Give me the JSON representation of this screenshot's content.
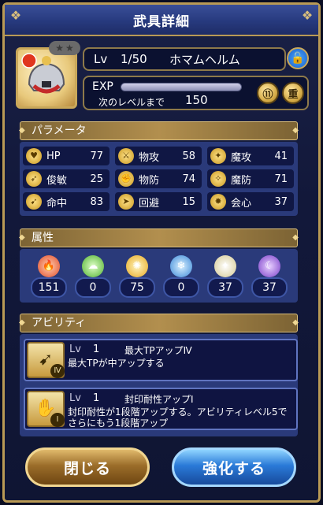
{
  "title": "武具詳細",
  "item": {
    "level_label": "Lv",
    "level_value": "1/50",
    "name": "ホマムヘルム",
    "exp_label": "EXP",
    "next_label": "次のレベルまで",
    "next_value": "150",
    "exp_progress": 0,
    "lock_icon": "lock-icon",
    "button_1": "⑪",
    "button_2": "重"
  },
  "params": {
    "header": "パラメータ",
    "rows": [
      [
        {
          "name": "HP",
          "value": "77",
          "icon": "heart-icon"
        },
        {
          "name": "物攻",
          "value": "58",
          "icon": "sword-icon"
        },
        {
          "name": "魔攻",
          "value": "41",
          "icon": "wand-icon"
        }
      ],
      [
        {
          "name": "俊敏",
          "value": "25",
          "icon": "boot-icon"
        },
        {
          "name": "物防",
          "value": "74",
          "icon": "arm-icon"
        },
        {
          "name": "魔防",
          "value": "71",
          "icon": "magic-shield-icon"
        }
      ],
      [
        {
          "name": "命中",
          "value": "83",
          "icon": "bow-icon"
        },
        {
          "name": "回避",
          "value": "15",
          "icon": "dodge-icon"
        },
        {
          "name": "会心",
          "value": "37",
          "icon": "crit-icon"
        }
      ]
    ]
  },
  "attributes": {
    "header": "属性",
    "items": [
      {
        "value": "151",
        "color": "#e04a2a",
        "icon": "fire-icon"
      },
      {
        "value": "0",
        "color": "#6fd04a",
        "icon": "wind-icon"
      },
      {
        "value": "75",
        "color": "#f0c23a",
        "icon": "light-icon"
      },
      {
        "value": "0",
        "color": "#4aa0e8",
        "icon": "water-icon"
      },
      {
        "value": "37",
        "color": "#e8e0b0",
        "icon": "holy-icon"
      },
      {
        "value": "37",
        "color": "#9a62e0",
        "icon": "dark-icon"
      }
    ]
  },
  "abilities": {
    "header": "アビリティ",
    "items": [
      {
        "level_label": "Lv",
        "level": "1",
        "name": "最大TPアップⅣ",
        "desc": "最大TPが中アップする",
        "roman": "Ⅳ",
        "icon": "tp-up-icon"
      },
      {
        "level_label": "Lv",
        "level": "1",
        "name": "封印耐性アップⅠ",
        "desc": "封印耐性が1段階アップする。アビリティレベル5でさらにもう1段階アップ",
        "roman": "Ⅰ",
        "icon": "seal-resist-icon"
      }
    ]
  },
  "buttons": {
    "close": "閉じる",
    "enhance": "強化する"
  }
}
